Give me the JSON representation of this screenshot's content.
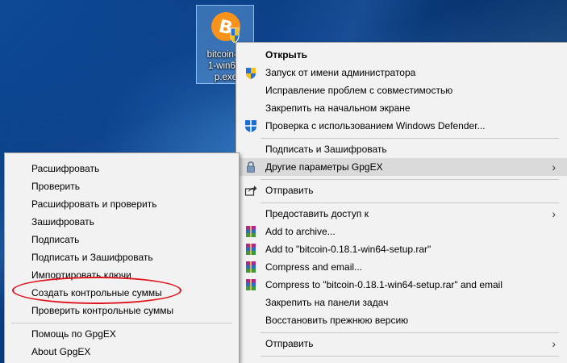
{
  "desktop_icon": {
    "label": "bitcoin-0.18.1-win64-setup.exe",
    "label_display": "bitcoin-0.\n1-win64-\np.exe",
    "colors": {
      "bitcoin_orange": "#f7931a",
      "shield_blue": "#2a6fd6",
      "shield_yellow": "#f5c21b"
    }
  },
  "main_menu": {
    "items": [
      {
        "label": "Открыть",
        "bold": true,
        "icon": ""
      },
      {
        "label": "Запуск от имени администратора",
        "icon": "uac-shield-icon"
      },
      {
        "label": "Исправление проблем с совместимостью",
        "icon": ""
      },
      {
        "label": "Закрепить на начальном экране",
        "icon": ""
      },
      {
        "label": "Проверка с использованием Windows Defender...",
        "icon": "windows-defender-icon"
      },
      {
        "label": "Подписать и Зашифровать",
        "icon": ""
      },
      {
        "label": "Другие параметры GpgEX",
        "icon": "lock-icon",
        "submenu": true,
        "highlighted": true
      },
      {
        "label": "Отправить",
        "icon": "share-icon"
      },
      {
        "label": "Предоставить доступ к",
        "icon": "",
        "submenu": true
      },
      {
        "label": "Add to archive...",
        "icon": "winrar-icon"
      },
      {
        "label": "Add to \"bitcoin-0.18.1-win64-setup.rar\"",
        "icon": "winrar-icon"
      },
      {
        "label": "Compress and email...",
        "icon": "winrar-icon"
      },
      {
        "label": "Compress to \"bitcoin-0.18.1-win64-setup.rar\" and email",
        "icon": "winrar-icon"
      },
      {
        "label": "Закрепить на панели задач",
        "icon": ""
      },
      {
        "label": "Восстановить прежнюю версию",
        "icon": ""
      },
      {
        "label": "Отправить",
        "icon": "",
        "submenu": true
      }
    ],
    "arrow_glyph": "›"
  },
  "sub_menu": {
    "items": [
      {
        "label": "Расшифровать"
      },
      {
        "label": "Проверить"
      },
      {
        "label": "Расшифровать и проверить"
      },
      {
        "label": "Зашифровать"
      },
      {
        "label": "Подписать"
      },
      {
        "label": "Подписать и Зашифровать"
      },
      {
        "label": "Импортировать ключи"
      },
      {
        "label": "Создать контрольные суммы",
        "annotated": true
      },
      {
        "label": "Проверить контрольные суммы"
      },
      {
        "label": "Помощь по GpgEX"
      },
      {
        "label": "About GpgEX"
      }
    ]
  },
  "annotation": {
    "color": "#e0141e"
  }
}
